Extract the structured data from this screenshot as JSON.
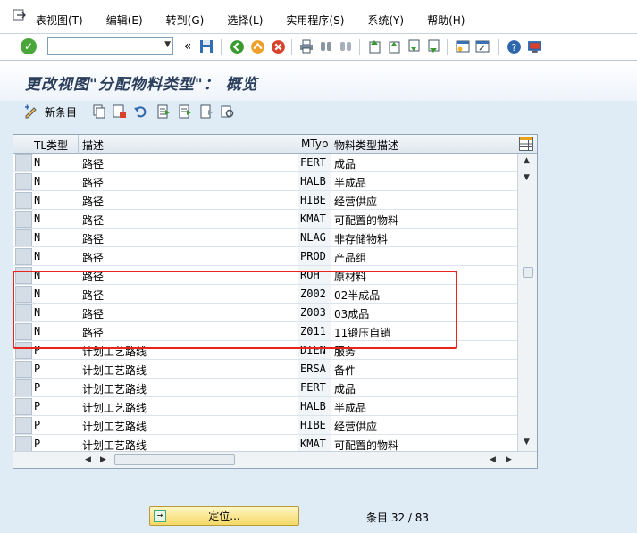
{
  "menu": {
    "items": [
      "表视图(T)",
      "编辑(E)",
      "转到(G)",
      "选择(L)",
      "实用程序(S)",
      "系统(Y)",
      "帮助(H)"
    ]
  },
  "toolbar": {
    "command_value": "",
    "icons": [
      "ok-icon",
      "save-icon",
      "back-icon",
      "exit-icon",
      "cancel-icon",
      "print-icon",
      "find-icon",
      "find-next-icon",
      "first-page-icon",
      "prev-page-icon",
      "next-page-icon",
      "last-page-icon",
      "new-session-icon",
      "shortcut-icon",
      "help-icon",
      "layout-icon"
    ]
  },
  "title": "更改视图\"分配物料类型\"： 概览",
  "app_toolbar": {
    "new_entries_label": "新条目"
  },
  "table": {
    "headers": {
      "tl_type": "TL类型",
      "desc": "描述",
      "mtyp": "MTyp",
      "mtyp_desc": "物料类型描述"
    },
    "rows": [
      {
        "tl": "N",
        "desc": "路径",
        "mtyp": "FERT",
        "mdesc": "成品"
      },
      {
        "tl": "N",
        "desc": "路径",
        "mtyp": "HALB",
        "mdesc": "半成品"
      },
      {
        "tl": "N",
        "desc": "路径",
        "mtyp": "HIBE",
        "mdesc": "经营供应"
      },
      {
        "tl": "N",
        "desc": "路径",
        "mtyp": "KMAT",
        "mdesc": "可配置的物料"
      },
      {
        "tl": "N",
        "desc": "路径",
        "mtyp": "NLAG",
        "mdesc": "非存储物料"
      },
      {
        "tl": "N",
        "desc": "路径",
        "mtyp": "PROD",
        "mdesc": "产品组"
      },
      {
        "tl": "N",
        "desc": "路径",
        "mtyp": "ROH",
        "mdesc": "原材料"
      },
      {
        "tl": "N",
        "desc": "路径",
        "mtyp": "Z002",
        "mdesc": "02半成品"
      },
      {
        "tl": "N",
        "desc": "路径",
        "mtyp": "Z003",
        "mdesc": "03成品"
      },
      {
        "tl": "N",
        "desc": "路径",
        "mtyp": "Z011",
        "mdesc": "11锻压自销"
      },
      {
        "tl": "P",
        "desc": "计划工艺路线",
        "mtyp": "DIEN",
        "mdesc": "服务"
      },
      {
        "tl": "P",
        "desc": "计划工艺路线",
        "mtyp": "ERSA",
        "mdesc": "备件"
      },
      {
        "tl": "P",
        "desc": "计划工艺路线",
        "mtyp": "FERT",
        "mdesc": "成品"
      },
      {
        "tl": "P",
        "desc": "计划工艺路线",
        "mtyp": "HALB",
        "mdesc": "半成品"
      },
      {
        "tl": "P",
        "desc": "计划工艺路线",
        "mtyp": "HIBE",
        "mdesc": "经营供应"
      },
      {
        "tl": "P",
        "desc": "计划工艺路线",
        "mtyp": "KMAT",
        "mdesc": "可配置的物料"
      }
    ]
  },
  "footer": {
    "locate_label": "定位...",
    "entry_label": "条目 32 / 83"
  },
  "colors": {
    "highlight": "#e8241c",
    "title": "#2b3f5c"
  }
}
